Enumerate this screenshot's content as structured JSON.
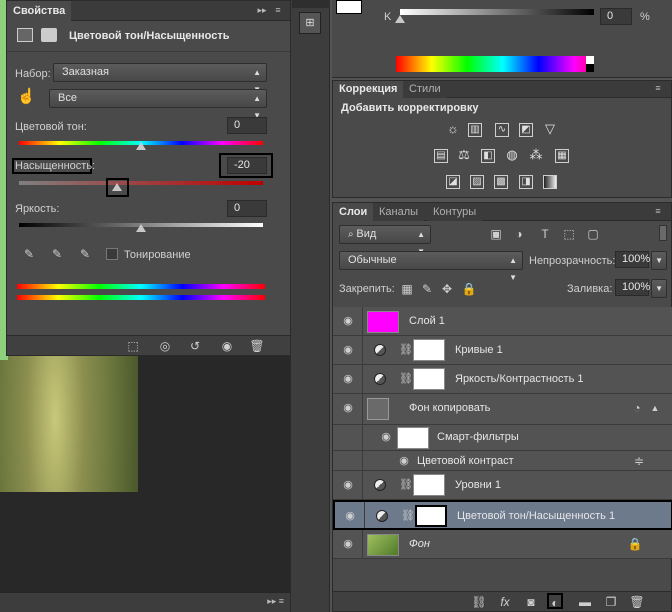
{
  "properties": {
    "tab_label": "Свойства",
    "adjustment_title": "Цветовой тон/Насыщенность",
    "preset_label": "Набор:",
    "preset_value": "Заказная",
    "channel_value": "Все",
    "hue_label": "Цветовой тон:",
    "hue_value": "0",
    "saturation_label": "Насыщенность:",
    "saturation_value": "-20",
    "lightness_label": "Яркость:",
    "lightness_value": "0",
    "colorize_label": "Тонирование"
  },
  "color_panel": {
    "channel_label": "K",
    "channel_value": "0",
    "unit": "%"
  },
  "adjustments": {
    "tabs": [
      "Коррекция",
      "Стили"
    ],
    "header": "Добавить корректировку"
  },
  "layers": {
    "tabs": [
      "Слои",
      "Каналы",
      "Контуры"
    ],
    "filter_value": "Вид",
    "blend_mode": "Обычные",
    "opacity_label": "Непрозрачность:",
    "opacity_value": "100%",
    "lock_label": "Закрепить:",
    "fill_label": "Заливка:",
    "fill_value": "100%",
    "items": [
      {
        "name": "Слой 1"
      },
      {
        "name": "Кривые 1"
      },
      {
        "name": "Яркость/Контрастность 1"
      },
      {
        "name": "Фон копировать"
      },
      {
        "name": "Смарт-фильтры"
      },
      {
        "name": "Цветовой контраст"
      },
      {
        "name": "Уровни 1"
      },
      {
        "name": "Цветовой тон/Насыщенность 1"
      },
      {
        "name": "Фон"
      }
    ]
  },
  "colors": {
    "layer1_fill": "#ff00ff",
    "selection": "#6c7a8c"
  }
}
